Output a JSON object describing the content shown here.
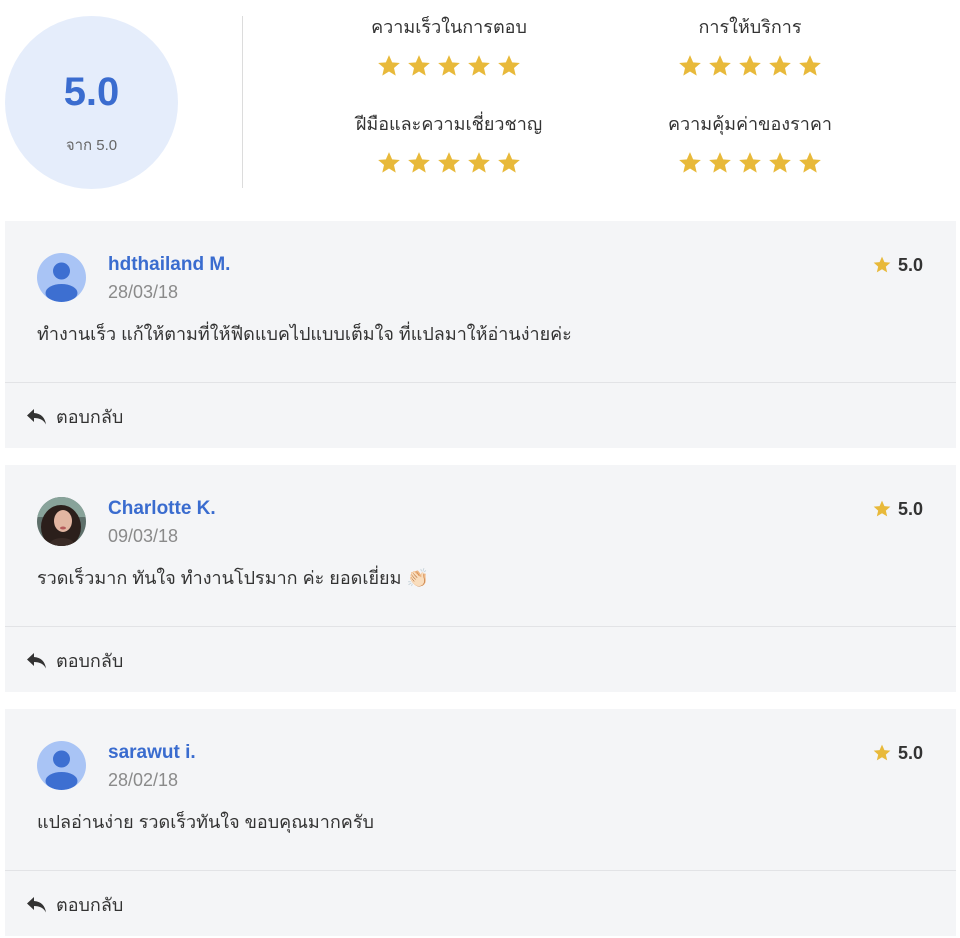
{
  "summary": {
    "overall_score": "5.0",
    "overall_sub": "จาก 5.0",
    "categories": [
      {
        "label": "ความเร็วในการตอบ",
        "stars": 5
      },
      {
        "label": "การให้บริการ",
        "stars": 5
      },
      {
        "label": "ฝีมือและความเชี่ยวชาญ",
        "stars": 5
      },
      {
        "label": "ความคุ้มค่าของราคา",
        "stars": 5
      }
    ]
  },
  "reviews": [
    {
      "name": "hdthailand M.",
      "date": "28/03/18",
      "rating": "5.0",
      "comment": "ทำงานเร็ว แก้ให้ตามที่ให้ฟีดแบคไปแบบเต็มใจ ที่แปลมาให้อ่านง่ายค่ะ",
      "reply_label": "ตอบกลับ",
      "avatar": "default-user-icon"
    },
    {
      "name": "Charlotte K.",
      "date": "09/03/18",
      "rating": "5.0",
      "comment": "รวดเร็วมาก ทันใจ ทำงานโปรมาก ค่ะ ยอดเยี่ยม 👏🏻",
      "reply_label": "ตอบกลับ",
      "avatar": "photo"
    },
    {
      "name": "sarawut i.",
      "date": "28/02/18",
      "rating": "5.0",
      "comment": "แปลอ่านง่าย รวดเร็วทันใจ ขอบคุณมากครับ",
      "reply_label": "ตอบกลับ",
      "avatar": "default-user-icon"
    }
  ],
  "colors": {
    "accent": "#3a6ccf",
    "star": "#e8b93a",
    "card_bg": "#f4f5f7",
    "score_bg": "#e5edfb"
  }
}
